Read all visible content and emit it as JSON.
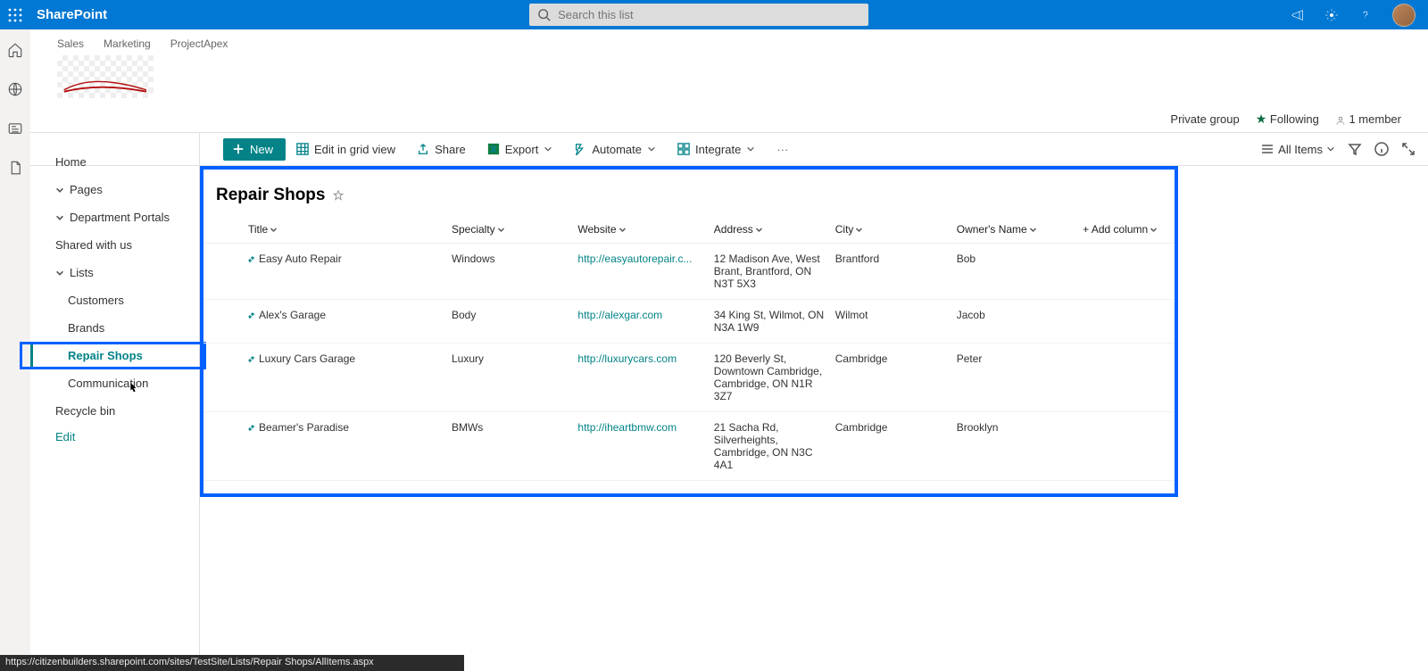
{
  "header": {
    "brand": "SharePoint",
    "search_placeholder": "Search this list"
  },
  "global_links": [
    "Sales",
    "Marketing",
    "ProjectApex"
  ],
  "site_meta": {
    "privacy": "Private group",
    "following": "Following",
    "members": "1 member"
  },
  "cmd": {
    "new": "New",
    "edit_grid": "Edit in grid view",
    "share": "Share",
    "export": "Export",
    "automate": "Automate",
    "integrate": "Integrate",
    "view_label": "All Items"
  },
  "nav": {
    "home": "Home",
    "pages": "Pages",
    "dept": "Department Portals",
    "shared": "Shared with us",
    "lists": "Lists",
    "children": [
      "Customers",
      "Brands",
      "Repair Shops",
      "Communication"
    ],
    "recycle": "Recycle bin",
    "edit": "Edit"
  },
  "list": {
    "title": "Repair Shops",
    "columns": [
      "Title",
      "Specialty",
      "Website",
      "Address",
      "City",
      "Owner's Name"
    ],
    "add_col": "Add column",
    "rows": [
      {
        "title": "Easy Auto Repair",
        "specialty": "Windows",
        "website": "http://easyautorepair.c...",
        "address": "12 Madison Ave, West Brant, Brantford, ON N3T 5X3",
        "city": "Brantford",
        "owner": "Bob"
      },
      {
        "title": "Alex's Garage",
        "specialty": "Body",
        "website": "http://alexgar.com",
        "address": "34 King St, Wilmot, ON N3A 1W9",
        "city": "Wilmot",
        "owner": "Jacob"
      },
      {
        "title": "Luxury Cars Garage",
        "specialty": "Luxury",
        "website": "http://luxurycars.com",
        "address": "120 Beverly St, Downtown Cambridge, Cambridge, ON N1R 3Z7",
        "city": "Cambridge",
        "owner": "Peter"
      },
      {
        "title": "Beamer's Paradise",
        "specialty": "BMWs",
        "website": "http://iheartbmw.com",
        "address": "21 Sacha Rd, Silverheights, Cambridge, ON N3C 4A1",
        "city": "Cambridge",
        "owner": "Brooklyn"
      }
    ]
  },
  "status_url": "https://citizenbuilders.sharepoint.com/sites/TestSite/Lists/Repair Shops/AllItems.aspx"
}
